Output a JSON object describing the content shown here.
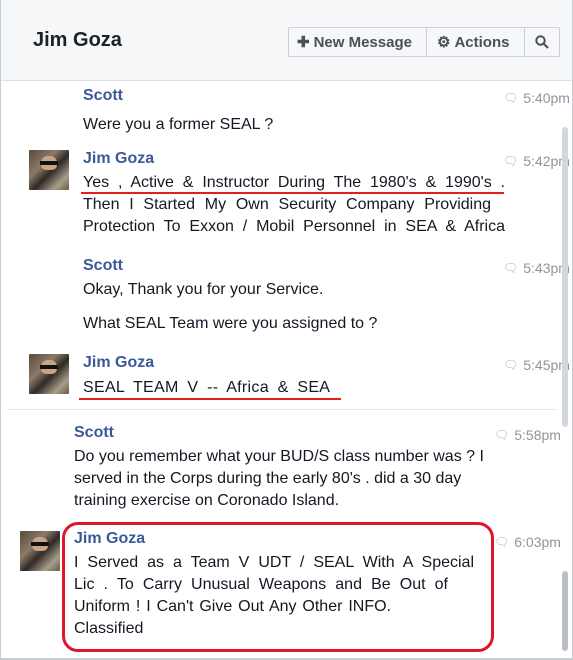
{
  "header": {
    "title": "Jim Goza",
    "new_message_label": "New Message",
    "actions_label": "Actions"
  },
  "messages": [
    {
      "author": "Scott",
      "time": "5:40pm",
      "lines": [
        "Were you a former SEAL ?"
      ]
    },
    {
      "author": "Jim Goza",
      "time": "5:42pm",
      "lines": [
        "Yes , Active & Instructor During The 1980's & 1990's .",
        "Then I Started My Own Security Company Providing",
        "Protection To Exxon / Mobil Personnel in SEA & Africa"
      ]
    },
    {
      "author": "Scott",
      "time": "5:43pm",
      "lines": [
        "Okay, Thank you for your Service.",
        "What SEAL Team were you assigned to ?"
      ]
    },
    {
      "author": "Jim Goza",
      "time": "5:45pm",
      "lines": [
        "SEAL TEAM V -- Africa & SEA"
      ]
    },
    {
      "author": "Scott",
      "time": "5:58pm",
      "lines": [
        "Do you remember what your BUD/S class number was ? I",
        "served in the Corps during the early 80's . did a 30 day",
        "training exercise on Coronado Island."
      ]
    },
    {
      "author": "Jim Goza",
      "time": "6:03pm",
      "lines": [
        "I Served as a Team V UDT / SEAL With A Special",
        "Lic . To Carry Unusual Weapons and Be Out of",
        "Uniform ! I Can't Give Out Any Other INFO.",
        "Classified"
      ]
    }
  ],
  "colors": {
    "author": "#3b5998",
    "annotation_red": "#e0142a",
    "timestamp": "#90949c"
  },
  "icons": [
    "plus-icon",
    "gear-icon",
    "search-icon",
    "chat-bubble-icon"
  ]
}
